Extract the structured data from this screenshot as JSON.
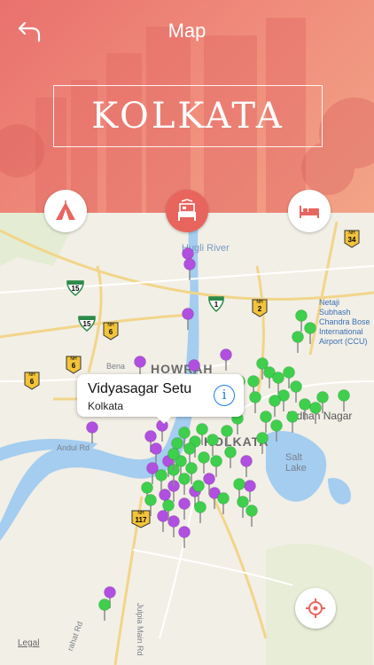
{
  "header": {
    "title": "Map",
    "city": "KOLKATA"
  },
  "categories": [
    {
      "name": "attractions",
      "icon": "tent-icon"
    },
    {
      "name": "hotels",
      "icon": "bed-icon",
      "active": true
    },
    {
      "name": "restaurants",
      "icon": "bed-icon"
    }
  ],
  "map": {
    "labels": {
      "hugli_river": "Hugli River",
      "howrah": "HOWRAH",
      "kolkata": "KOLKATA",
      "salt_lake": "Salt Lake",
      "bidhan_nagar": "Bidhan Nagar",
      "airport": "Netaji Subhash Chandra Bose International Airport (CCU)",
      "andul": "Andul Rd",
      "bena": "Bena",
      "julpia": "Julpia Main Rd",
      "rahat": "rahat Rd"
    },
    "shields": {
      "nh34": "34",
      "nh2": "2",
      "nh6a": "6",
      "nh6b": "6",
      "nh6c": "6",
      "nh117": "117",
      "r15a": "15",
      "r15b": "15",
      "r1": "1",
      "nh_prefix": "NH"
    }
  },
  "callout": {
    "title": "Vidyasagar Setu",
    "subtitle": "Kolkata",
    "info": "i"
  },
  "legal": "Legal",
  "colors": {
    "accent": "#e8655e",
    "pin_green": "#3ecf4c",
    "pin_purple": "#b04fe0"
  }
}
